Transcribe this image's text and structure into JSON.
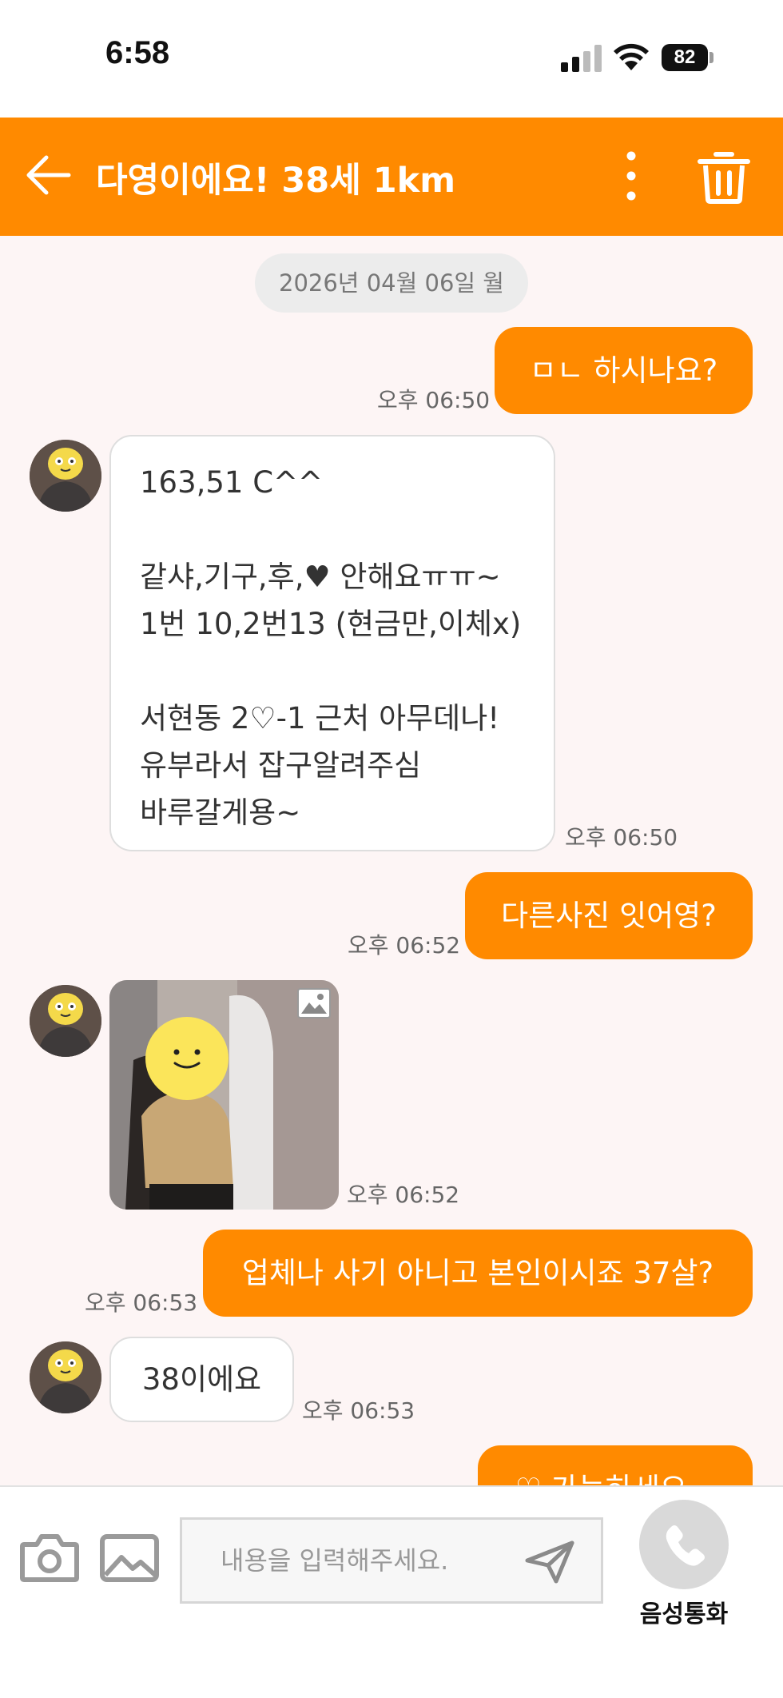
{
  "status_bar": {
    "time": "6:58",
    "battery": "82"
  },
  "header": {
    "title": "다영이에요! 38세 1km",
    "accent_color": "#ff8a00",
    "back_icon": "arrow-left-icon",
    "more_icon": "more-vertical-icon",
    "delete_icon": "trash-icon"
  },
  "chat": {
    "date": "2026년 04월 06일 월",
    "messages": [
      {
        "direction": "out",
        "text": "ㅁㄴ 하시나요?",
        "time": "오후 06:50"
      },
      {
        "direction": "in",
        "text": "163,51 C^^\n\n같샤,기구,후,♥ 안해요ㅠㅠ~\n1번 10,2번13 (현금만,이체x)\n\n서현동 2♡-1 근처 아무데나!\n유부라서 잡구알려주심\n바루갈게용~",
        "time": "오후 06:50"
      },
      {
        "direction": "out",
        "text": "다른사진 잇어영?",
        "time": "오후 06:52"
      },
      {
        "direction": "in",
        "type": "image",
        "time": "오후 06:52"
      },
      {
        "direction": "out",
        "text": "업체나 사기 아니고 본인이시죠 37살?",
        "time": "오후 06:53"
      },
      {
        "direction": "in",
        "text": "38이에요",
        "time": "오후 06:53"
      },
      {
        "direction": "out",
        "text": "♡ 가능하세요 ..",
        "time": ""
      }
    ]
  },
  "composer": {
    "placeholder": "내용을 입력해주세요.",
    "call_label": "음성통화",
    "camera_icon": "camera-icon",
    "image_icon": "image-icon",
    "send_icon": "send-icon",
    "phone_icon": "phone-icon"
  }
}
